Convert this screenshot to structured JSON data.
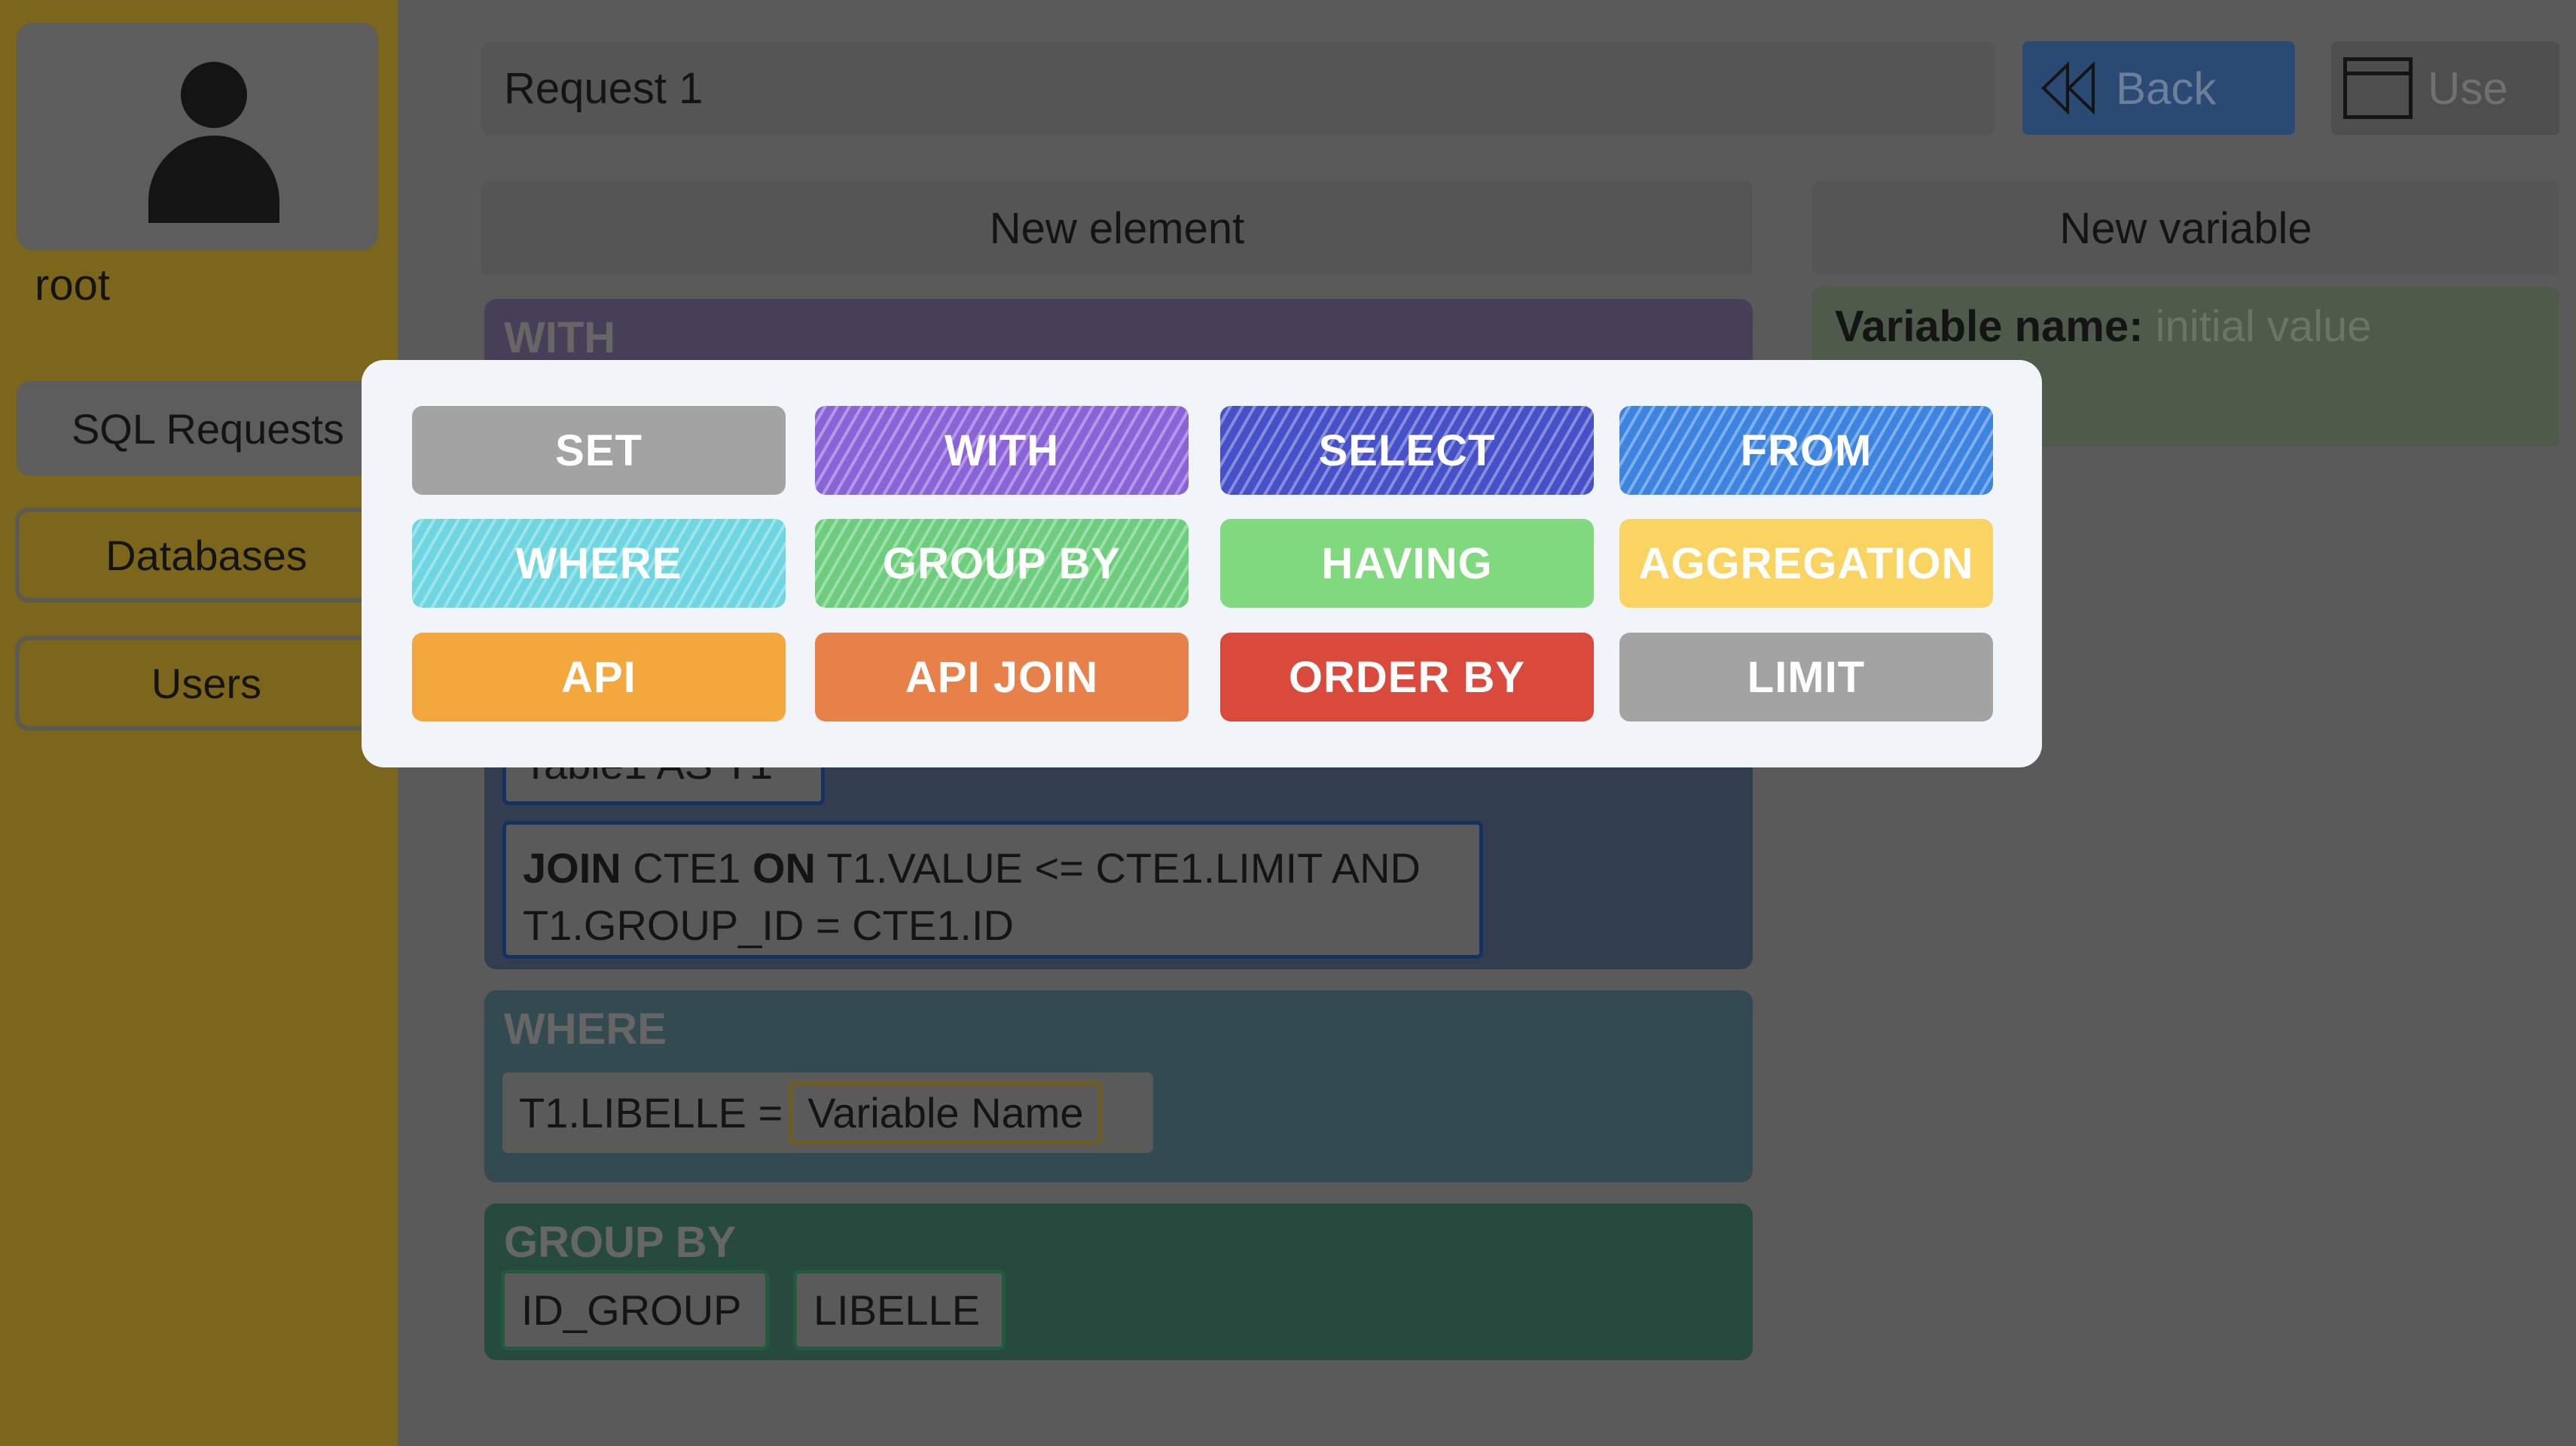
{
  "sidebar": {
    "username": "root",
    "items": [
      {
        "label": "SQL Requests"
      },
      {
        "label": "Databases"
      },
      {
        "label": "Users"
      }
    ]
  },
  "header": {
    "title": "Request 1",
    "back_label": "Back",
    "use_label": "Use"
  },
  "panel": {
    "new_element": "New element",
    "new_variable": "New variable",
    "variable_name_label": "Variable name:",
    "variable_initial_placeholder": "initial value"
  },
  "blocks": {
    "with": {
      "label": "WITH"
    },
    "from": {
      "table": "Table1 AS T1",
      "join_kw": "JOIN",
      "join_table": "CTE1",
      "on_kw": "ON",
      "join_cond1": "T1.VALUE <= CTE1.LIMIT AND",
      "join_cond2": "T1.GROUP_ID = CTE1.ID"
    },
    "where": {
      "label": "WHERE",
      "condition": "T1.LIBELLE =",
      "variable": "Variable Name"
    },
    "group_by": {
      "label": "GROUP BY",
      "items": [
        "ID_GROUP",
        "LIBELLE"
      ]
    }
  },
  "modal": {
    "options": [
      {
        "label": "SET",
        "color": "#a3a3a3",
        "striped": false
      },
      {
        "label": "WITH",
        "color": "#8a63d8",
        "striped": true
      },
      {
        "label": "SELECT",
        "color": "#4650c8",
        "striped": true
      },
      {
        "label": "FROM",
        "color": "#3c84e0",
        "striped": true
      },
      {
        "label": "WHERE",
        "color": "#6dd6e0",
        "striped": true
      },
      {
        "label": "GROUP BY",
        "color": "#6cce7c",
        "striped": true
      },
      {
        "label": "HAVING",
        "color": "#80d97e",
        "striped": false
      },
      {
        "label": "AGGREGATION",
        "color": "#f9d463",
        "striped": false
      },
      {
        "label": "API",
        "color": "#f3a73d",
        "striped": false
      },
      {
        "label": "API JOIN",
        "color": "#e8804a",
        "striped": false
      },
      {
        "label": "ORDER BY",
        "color": "#d94a3c",
        "striped": false
      },
      {
        "label": "LIMIT",
        "color": "#a3a3a3",
        "striped": false
      }
    ]
  }
}
